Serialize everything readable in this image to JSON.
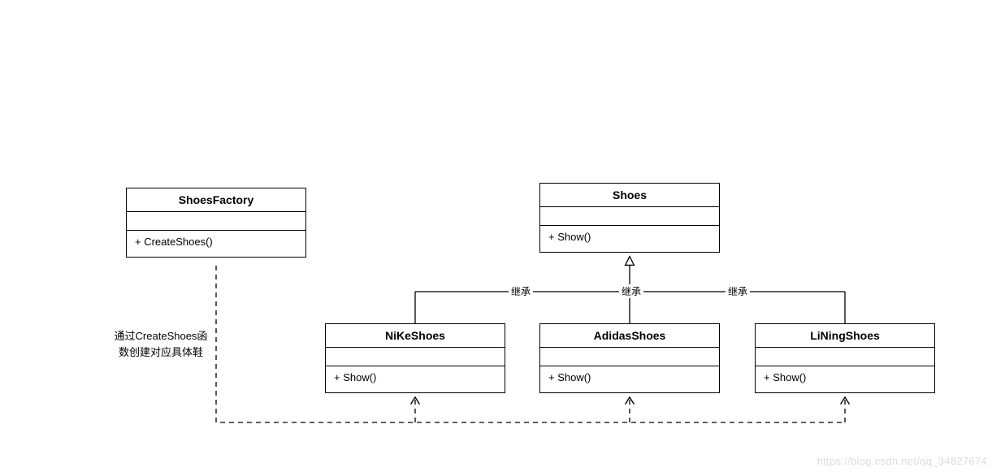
{
  "classes": {
    "factory": {
      "title": "ShoesFactory",
      "method": "+ CreateShoes()"
    },
    "shoes": {
      "title": "Shoes",
      "method": "+ Show()"
    },
    "nike": {
      "title": "NiKeShoes",
      "method": "+ Show()"
    },
    "adidas": {
      "title": "AdidasShoes",
      "method": "+ Show()"
    },
    "lining": {
      "title": "LiNingShoes",
      "method": "+ Show()"
    }
  },
  "labels": {
    "inherit1": "继承",
    "inherit2": "继承",
    "inherit3": "继承"
  },
  "note": {
    "line1": "通过CreateShoes函",
    "line2": "数创建对应具体鞋"
  },
  "watermark": "https://blog.csdn.net/qq_34827674"
}
